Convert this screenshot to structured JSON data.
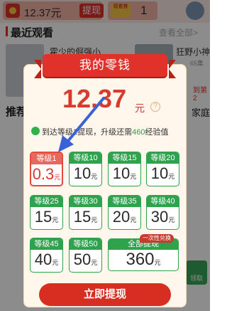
{
  "topbar": {
    "wallet_amount": "12.37元",
    "withdraw_label": "提现",
    "ticket_icon_label": "观看券",
    "ticket_count": "1"
  },
  "recent": {
    "title": "最近观看",
    "view_all": "查看全部>",
    "books": [
      {
        "title": "霍少的倔强小",
        "sub": ""
      },
      {
        "title": "狂野小神医",
        "sub": "65集"
      }
    ],
    "next_label": "到第2"
  },
  "recommend": {
    "label": "推荐",
    "tail": "家庭"
  },
  "side_badge": {
    "label": "领取"
  },
  "modal": {
    "title": "我的零钱",
    "balance": "12.37",
    "balance_unit": "元",
    "help": "?",
    "tip_prefix": "到达",
    "tip_level": "等级1",
    "tip_middle": "提现，升级还需",
    "tip_exp": "460",
    "tip_suffix": "经验值",
    "tiles": [
      {
        "level": "等级1",
        "amount": "0.3",
        "unit": "元",
        "selected": true
      },
      {
        "level": "等级10",
        "amount": "10",
        "unit": "元"
      },
      {
        "level": "等级15",
        "amount": "10",
        "unit": "元"
      },
      {
        "level": "等级20",
        "amount": "10",
        "unit": "元"
      },
      {
        "level": "等级25",
        "amount": "15",
        "unit": "元"
      },
      {
        "level": "等级30",
        "amount": "15",
        "unit": "元"
      },
      {
        "level": "等级35",
        "amount": "20",
        "unit": "元"
      },
      {
        "level": "等级40",
        "amount": "30",
        "unit": "元"
      },
      {
        "level": "等级45",
        "amount": "40",
        "unit": "元"
      },
      {
        "level": "等级50",
        "amount": "50",
        "unit": "元"
      }
    ],
    "wide_tile": {
      "level": "全部提现",
      "amount": "360",
      "unit": "元",
      "badge": "一次性兑换"
    },
    "cta": "立即提现"
  },
  "colors": {
    "brand_red": "#e0322a",
    "tile_green": "#2ea24d",
    "balance_red": "#d93a2f"
  }
}
